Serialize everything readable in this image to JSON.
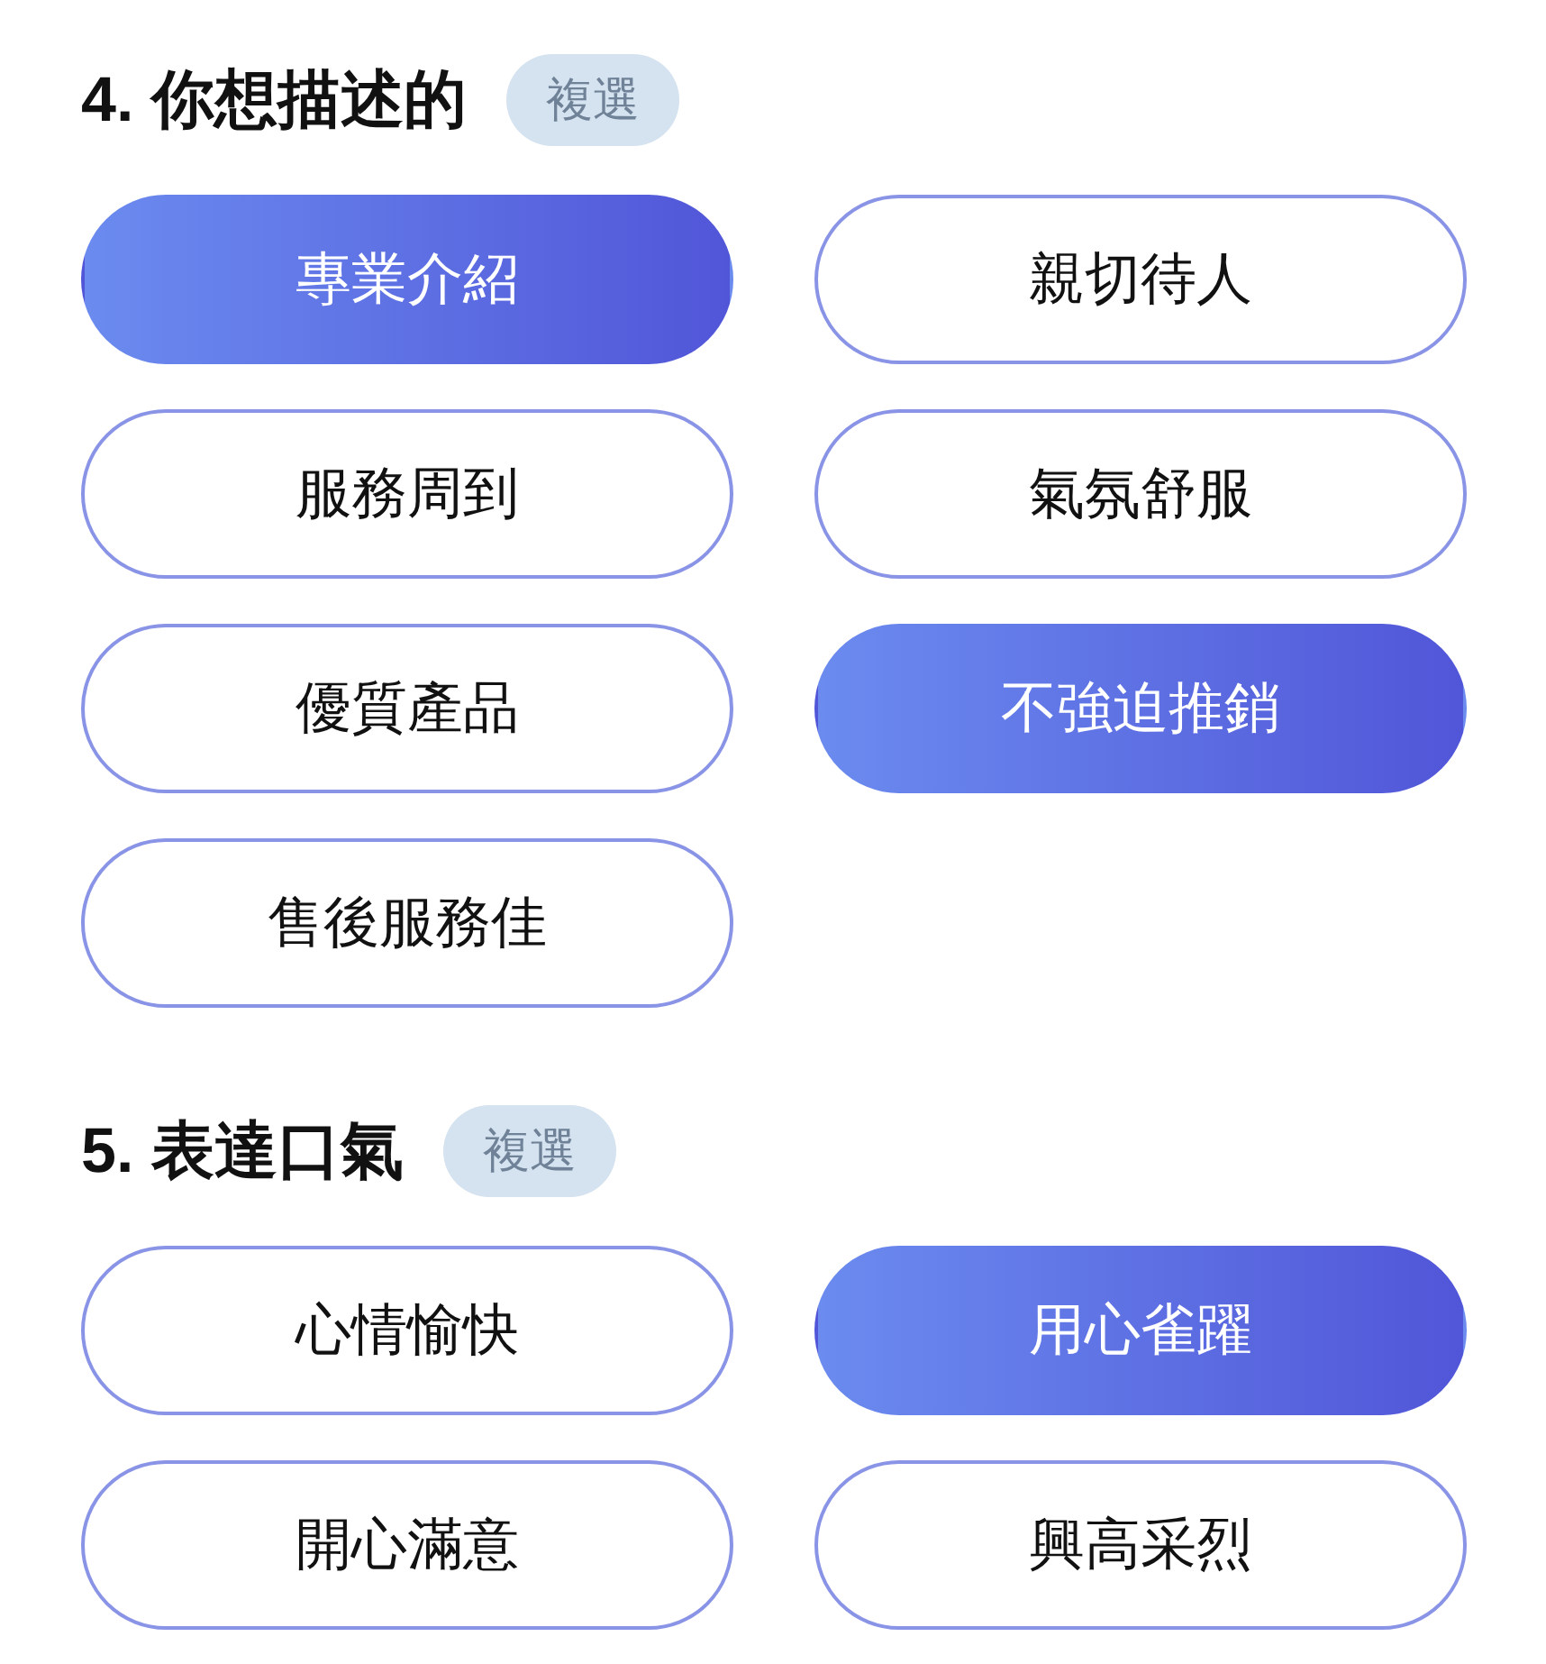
{
  "sections": [
    {
      "title": "4. 你想描述的",
      "badge": "複選",
      "options": [
        {
          "label": "專業介紹",
          "selected": true
        },
        {
          "label": "親切待人",
          "selected": false
        },
        {
          "label": "服務周到",
          "selected": false
        },
        {
          "label": "氣氛舒服",
          "selected": false
        },
        {
          "label": "優質產品",
          "selected": false
        },
        {
          "label": "不強迫推銷",
          "selected": true
        },
        {
          "label": "售後服務佳",
          "selected": false
        }
      ]
    },
    {
      "title": "5. 表達口氣",
      "badge": "複選",
      "options": [
        {
          "label": "心情愉快",
          "selected": false
        },
        {
          "label": "用心雀躍",
          "selected": true
        },
        {
          "label": "開心滿意",
          "selected": false
        },
        {
          "label": "興高采烈",
          "selected": false
        }
      ]
    }
  ]
}
